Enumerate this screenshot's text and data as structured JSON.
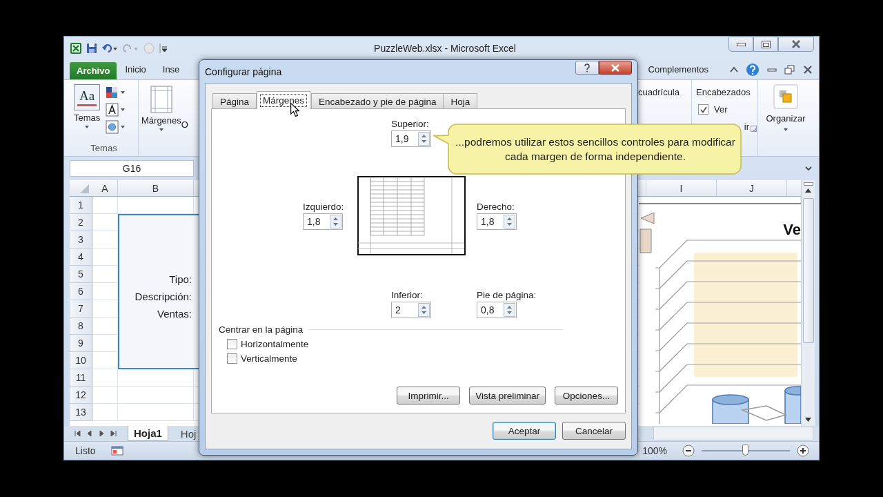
{
  "excel": {
    "title": "PuzzleWeb.xlsx - Microsoft Excel",
    "ribbon_tabs": [
      {
        "label": "Archivo",
        "kind": "file"
      },
      {
        "label": "Inicio",
        "kind": "tab"
      },
      {
        "label": "Inse",
        "kind": "tab"
      },
      {
        "label": "Complementos",
        "kind": "tab"
      }
    ],
    "ribbon_left": [
      {
        "label": "Temas",
        "kind": "themes",
        "icon_text": "Aa"
      },
      {
        "label": "Márgenes",
        "kind": "margins"
      },
      {
        "label": "O",
        "kind": "text"
      }
    ],
    "group_label": "Temas",
    "ribbon_right": {
      "gridlines_label": "cuadrícula",
      "headings_title": "Encabezados",
      "view": {
        "label": "Ver",
        "checked": true
      },
      "print_fragment": "ir",
      "arrange": "Organizar"
    },
    "name_box": "G16",
    "columns_left": [
      "A",
      "B"
    ],
    "columns_right": [
      "I",
      "J"
    ],
    "rows": [
      "1",
      "2",
      "3",
      "4",
      "5",
      "6",
      "7",
      "8",
      "9",
      "10",
      "11",
      "12",
      "13"
    ],
    "text_box": [
      "Tipo:",
      "Descripción:",
      "Ventas:"
    ],
    "chart": {
      "title": "Ve"
    },
    "sheet_tabs": [
      {
        "label": "Hoja1",
        "selected": true
      },
      {
        "label": "Hoj",
        "selected": false
      }
    ],
    "status": "Listo",
    "zoom": "100%",
    "zoom_slider": {
      "level": 0.5
    }
  },
  "dialog": {
    "title": "Configurar página",
    "tabs": [
      {
        "label": "Página",
        "selected": false
      },
      {
        "label": "Márgenes",
        "selected": true
      },
      {
        "label": "Encabezado y pie de página",
        "selected": false
      },
      {
        "label": "Hoja",
        "selected": false
      }
    ],
    "fields": [
      {
        "kind": "top",
        "label": "Superior:",
        "value": "1,9"
      },
      {
        "kind": "left",
        "label": "Izquierdo:",
        "value": "1,8"
      },
      {
        "kind": "right",
        "label": "Derecho:",
        "value": "1,8"
      },
      {
        "kind": "bottom",
        "label": "Inferior:",
        "value": "2"
      },
      {
        "kind": "footer",
        "label": "Pie de página:",
        "value": "0,8"
      }
    ],
    "center_title": "Centrar en la página",
    "center_options": [
      {
        "label": "Horizontalmente",
        "checked": false
      },
      {
        "label": "Verticalmente",
        "checked": false
      }
    ],
    "panel_buttons": [
      "Imprimir...",
      "Vista preliminar",
      "Opciones..."
    ],
    "buttons": [
      {
        "label": "Aceptar",
        "selected": true
      },
      {
        "label": "Cancelar",
        "selected": false
      }
    ]
  },
  "callout": {
    "text": "...podremos utilizar estos sencillos controles para modificar cada margen de forma independiente."
  }
}
